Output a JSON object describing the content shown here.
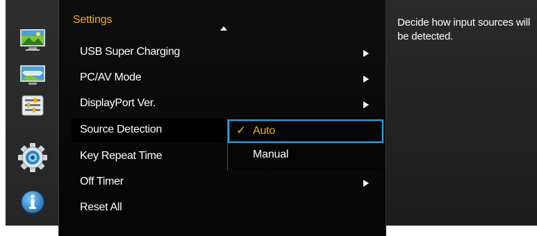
{
  "sidebar": {
    "icons": [
      {
        "name": "picture-icon"
      },
      {
        "name": "onscreen-display-icon"
      },
      {
        "name": "system-icon"
      },
      {
        "name": "settings-gear-icon"
      },
      {
        "name": "information-icon"
      }
    ]
  },
  "menu": {
    "title": "Settings",
    "items": [
      {
        "label": "USB Super Charging",
        "has_submenu": true
      },
      {
        "label": "PC/AV Mode",
        "has_submenu": true
      },
      {
        "label": "DisplayPort Ver.",
        "has_submenu": true
      },
      {
        "label": "Source Detection",
        "has_submenu": false,
        "selected": true
      },
      {
        "label": "Key Repeat Time",
        "has_submenu": false
      },
      {
        "label": "Off Timer",
        "has_submenu": true
      },
      {
        "label": "Reset All",
        "has_submenu": false
      }
    ]
  },
  "submenu": {
    "options": [
      {
        "label": "Auto",
        "checked": true,
        "check_glyph": "✓"
      },
      {
        "label": "Manual",
        "checked": false
      }
    ]
  },
  "help": {
    "text": "Decide how input sources will be detected."
  },
  "colors": {
    "accent": "#f2b10d",
    "focus": "#2f9fd6",
    "panel": "#0a0a0a",
    "frame": "#262626"
  }
}
